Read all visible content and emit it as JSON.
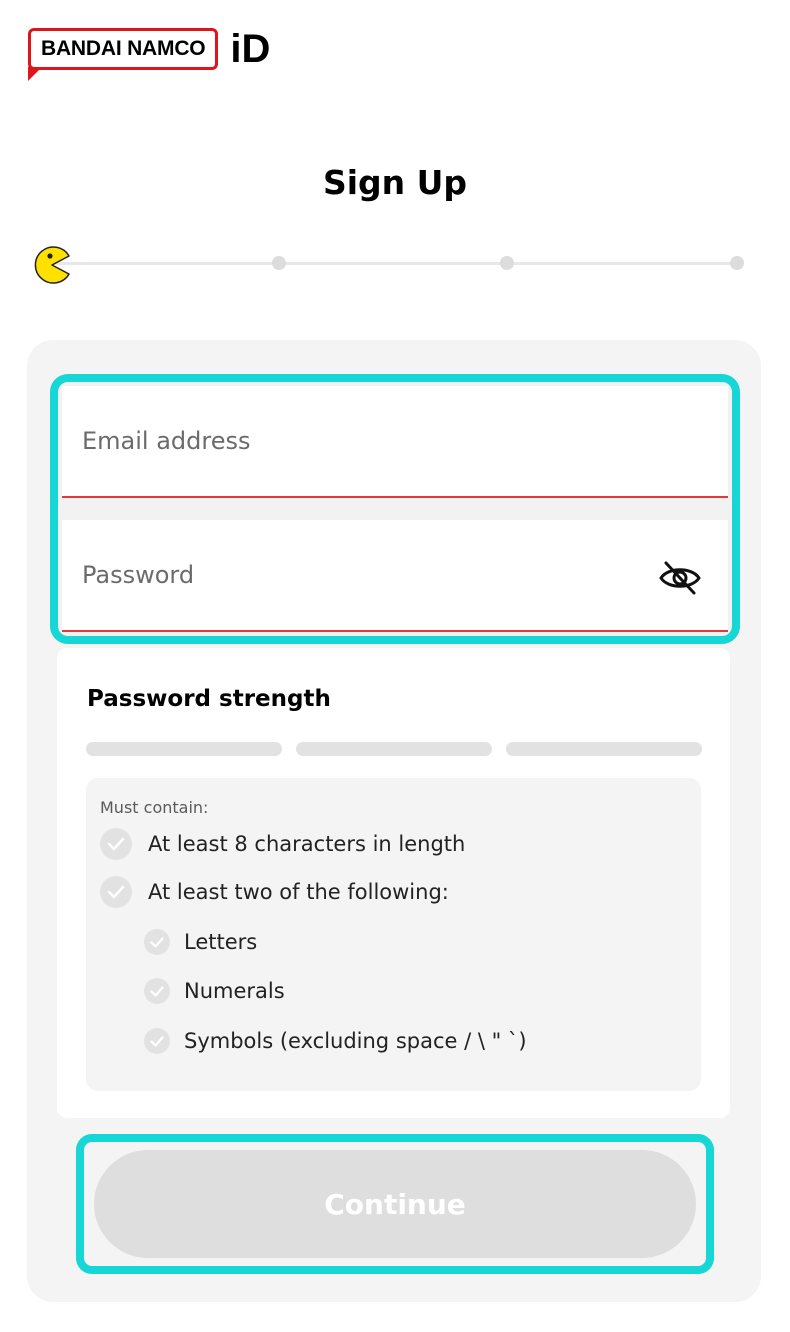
{
  "brand": {
    "logo_text": "BANDAI NAMCO",
    "id_text": "iD"
  },
  "page": {
    "title": "Sign Up"
  },
  "progress": {
    "current_step": 1,
    "total_steps": 4
  },
  "form": {
    "email_placeholder": "Email address",
    "password_placeholder": "Password"
  },
  "strength": {
    "title": "Password strength",
    "segments": 3,
    "must_contain": "Must contain:",
    "requirements": [
      "At least 8 characters in length",
      "At least two of the following:"
    ],
    "sub_requirements": [
      "Letters",
      "Numerals",
      "Symbols (excluding space / \\ \" `)"
    ]
  },
  "actions": {
    "continue_label": "Continue"
  },
  "colors": {
    "accent_outline": "#17d6d6",
    "error_underline": "#e23a3a",
    "brand_red": "#e0141b",
    "pacman": "#ffe100",
    "button_disabled": "#dedede"
  },
  "icons": {
    "visibility": "eye-off-icon",
    "step": "pacman-icon",
    "check": "check-icon"
  }
}
